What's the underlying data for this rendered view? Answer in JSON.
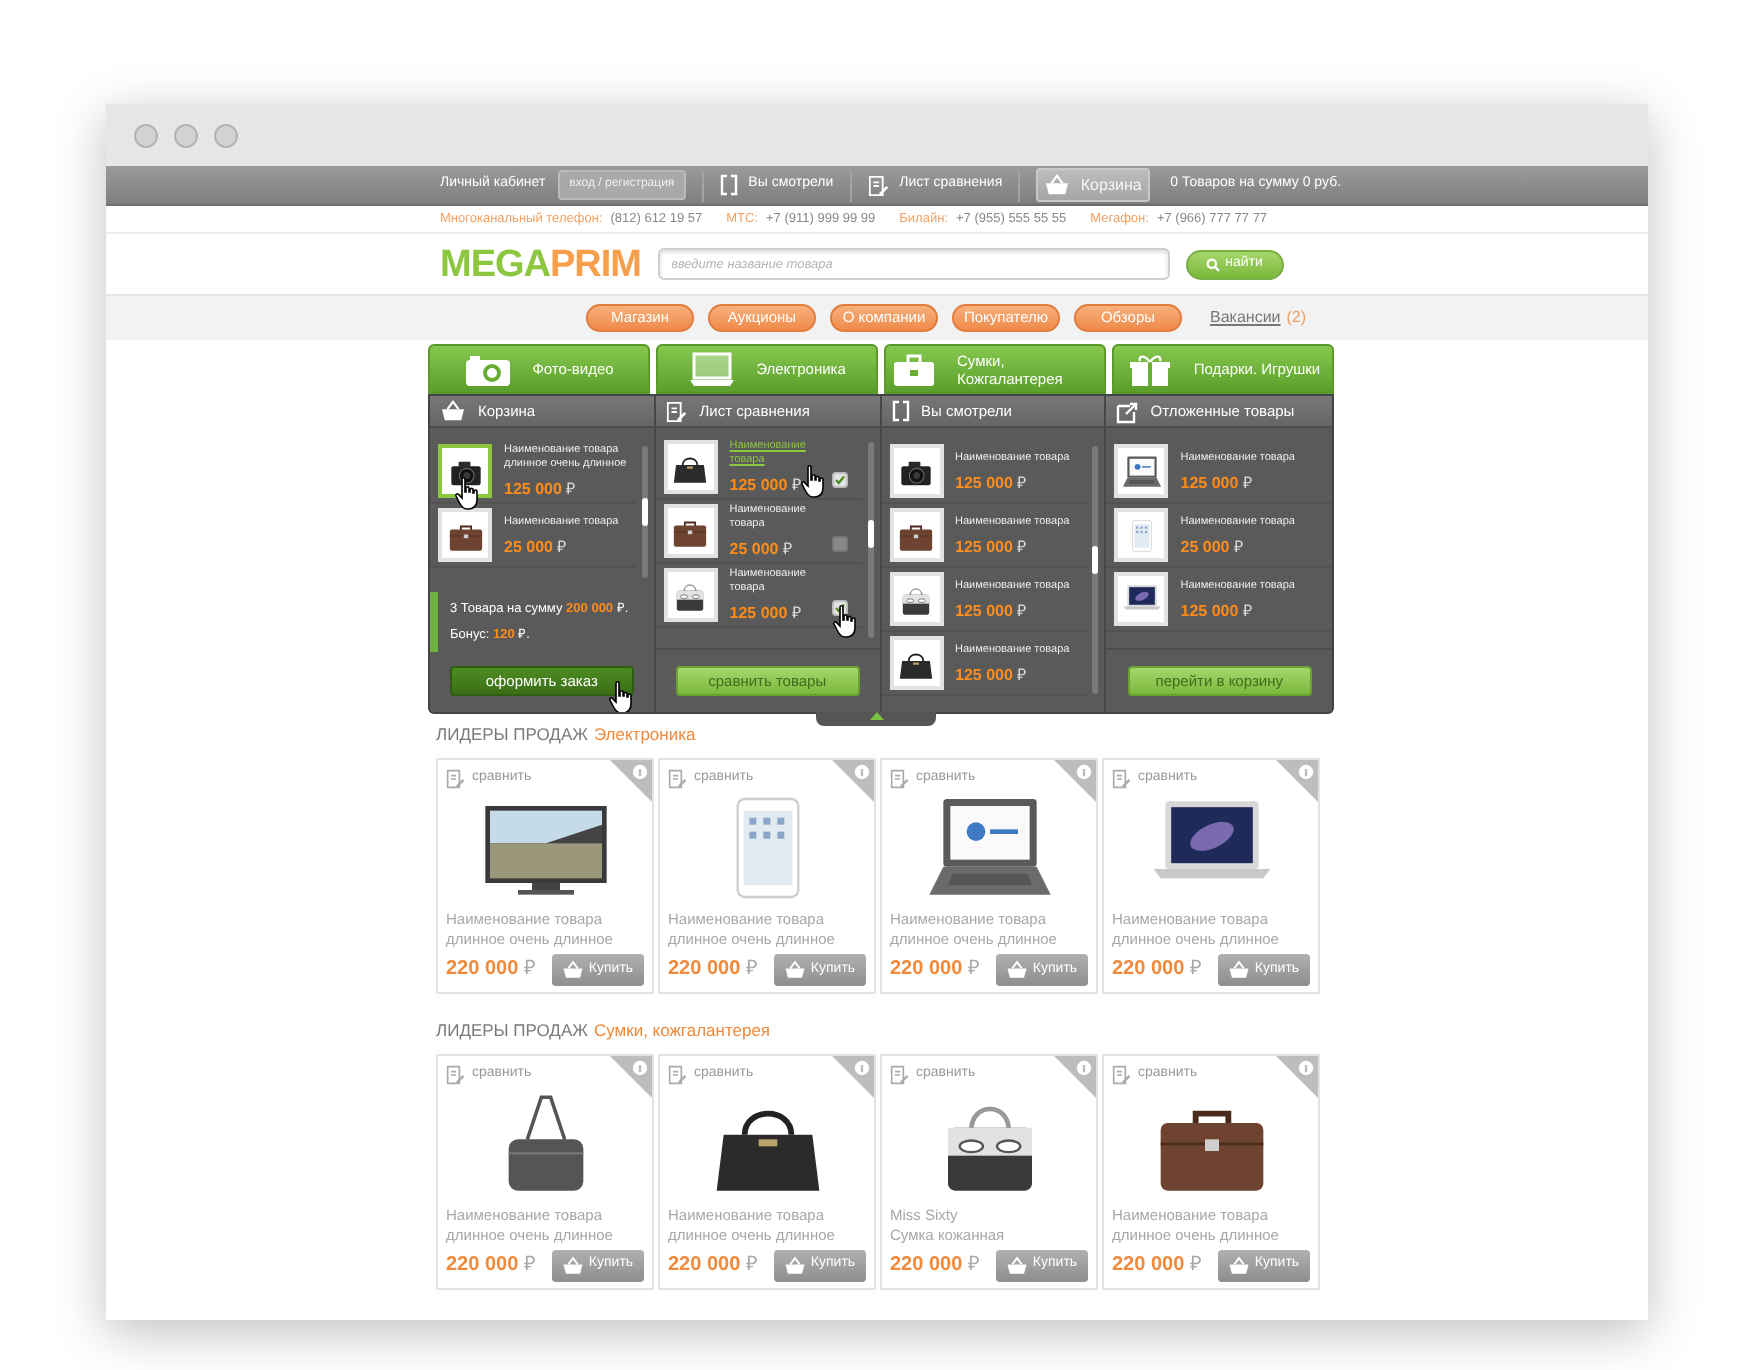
{
  "top_bar": {
    "account_label": "Личный кабинет",
    "login_button": "вход / регистрация",
    "viewed_link": "Вы смотрели",
    "compare_link": "Лист сравнения",
    "cart_button": "Корзина",
    "cart_summary": "0 Товаров на сумму 0 руб."
  },
  "phones": [
    {
      "label": "Многоканальный телефон:",
      "number": "(812) 612 19 57"
    },
    {
      "label": "МТС:",
      "number": "+7 (911) 999 99 99"
    },
    {
      "label": "Билайн:",
      "number": "+7 (955) 555 55 55"
    },
    {
      "label": "Мегафон:",
      "number": "+7 (966) 777 77 77"
    }
  ],
  "logo": {
    "part_1": "MEGA",
    "part_2": "PRIM"
  },
  "search": {
    "placeholder": "введите название товара",
    "button": "найти"
  },
  "nav": [
    {
      "label": "Магазин"
    },
    {
      "label": "Аукционы"
    },
    {
      "label": "О компании"
    },
    {
      "label": "Покупателю"
    },
    {
      "label": "Обзоры"
    }
  ],
  "nav_link": {
    "label": "Вакансии",
    "count": "(2)"
  },
  "category_tabs": [
    {
      "kind": "camera",
      "label": "Фото-видео"
    },
    {
      "kind": "laptop",
      "label": "Электроника"
    },
    {
      "kind": "briefcase",
      "label": "Сумки, Кожгалантерея"
    },
    {
      "kind": "gift",
      "label": "Подарки. Игрушки"
    }
  ],
  "panel": {
    "columns": [
      {
        "kind": "cart",
        "title": "Корзина",
        "scrollbar": true,
        "items": [
          {
            "kind": "camera",
            "name": "Наименование товара длинное очень длинное",
            "price": "125 000",
            "currency": "₽",
            "hovered": true,
            "cursor": true
          },
          {
            "kind": "briefcase",
            "name": "Наименование товара",
            "price": "25 000",
            "currency": "₽",
            "hovered": false
          }
        ],
        "total": {
          "text": "3 Товара на сумму",
          "amount": "200 000",
          "suffix": "₽."
        },
        "bonus": {
          "text": "Бонус:",
          "amount": "120",
          "suffix": "₽."
        },
        "button": {
          "label": "оформить заказ",
          "hovered": true,
          "cursor": true
        }
      },
      {
        "kind": "compare",
        "title": "Лист сравнения",
        "scrollbar": true,
        "items": [
          {
            "kind": "handbag",
            "name": "Наименование товара",
            "price": "125 000",
            "currency": "₽",
            "hovered": true,
            "cursor": true,
            "checked": true
          },
          {
            "kind": "briefcase",
            "name": "Наименование товара",
            "price": "25 000",
            "currency": "₽",
            "hovered": false,
            "checked": false
          },
          {
            "kind": "patterned-bag",
            "name": "Наименование товара",
            "price": "125 000",
            "currency": "₽",
            "hovered": false,
            "cursor": true,
            "checked": true
          }
        ],
        "button": {
          "label": "сравнить товары",
          "hovered": false
        }
      },
      {
        "kind": "viewed",
        "title": "Вы смотрели",
        "scrollbar": true,
        "items": [
          {
            "kind": "camera",
            "name": "Наименование товара",
            "price": "125 000",
            "currency": "₽"
          },
          {
            "kind": "briefcase",
            "name": "Наименование товара",
            "price": "125 000",
            "currency": "₽"
          },
          {
            "kind": "patterned-bag",
            "name": "Наименование товара",
            "price": "125 000",
            "currency": "₽"
          },
          {
            "kind": "handbag",
            "name": "Наименование товара",
            "price": "125 000",
            "currency": "₽"
          }
        ]
      },
      {
        "kind": "saved",
        "title": "Отложенные товары",
        "items": [
          {
            "kind": "laptop",
            "name": "Наименование товара",
            "price": "125 000",
            "currency": "₽"
          },
          {
            "kind": "tablet",
            "name": "Наименование товара",
            "price": "25 000",
            "currency": "₽"
          },
          {
            "kind": "ultrabook",
            "name": "Наименование товара",
            "price": "125 000",
            "currency": "₽"
          }
        ],
        "button": {
          "label": "перейти в корзину",
          "hovered": false
        }
      }
    ]
  },
  "sections": [
    {
      "title": "ЛИДЕРЫ ПРОДАЖ",
      "category": "Электроника",
      "products": [
        {
          "kind": "tv",
          "compare": "сравнить",
          "name": [
            "Наименование товара",
            "длинное очень длинное"
          ],
          "price": "220 000",
          "currency": "₽",
          "buy": "Купить"
        },
        {
          "kind": "tablet",
          "compare": "сравнить",
          "name": [
            "Наименование товара",
            "длинное очень длинное"
          ],
          "price": "220 000",
          "currency": "₽",
          "buy": "Купить"
        },
        {
          "kind": "laptop",
          "compare": "сравнить",
          "name": [
            "Наименование товара",
            "длинное очень длинное"
          ],
          "price": "220 000",
          "currency": "₽",
          "buy": "Купить"
        },
        {
          "kind": "ultrabook",
          "compare": "сравнить",
          "name": [
            "Наименование товара",
            "длинное очень длинное"
          ],
          "price": "220 000",
          "currency": "₽",
          "buy": "Купить"
        }
      ]
    },
    {
      "title": "ЛИДЕРЫ ПРОДАЖ",
      "category": "Сумки, кожгалантерея",
      "products": [
        {
          "kind": "shoulder-bag",
          "compare": "сравнить",
          "name": [
            "Наименование товара",
            "длинное очень длинное"
          ],
          "price": "220 000",
          "currency": "₽",
          "buy": "Купить"
        },
        {
          "kind": "handbag",
          "compare": "сравнить",
          "name": [
            "Наименование товара",
            "длинное очень длинное"
          ],
          "price": "220 000",
          "currency": "₽",
          "buy": "Купить"
        },
        {
          "kind": "patterned-bag",
          "compare": "сравнить",
          "name": [
            "Miss Sixty",
            "Сумка кожанная"
          ],
          "price": "220 000",
          "currency": "₽",
          "buy": "Купить"
        },
        {
          "kind": "briefcase",
          "compare": "сравнить",
          "name": [
            "Наименование товара",
            "длинное очень длинное"
          ],
          "price": "220 000",
          "currency": "₽",
          "buy": "Купить"
        }
      ]
    }
  ]
}
